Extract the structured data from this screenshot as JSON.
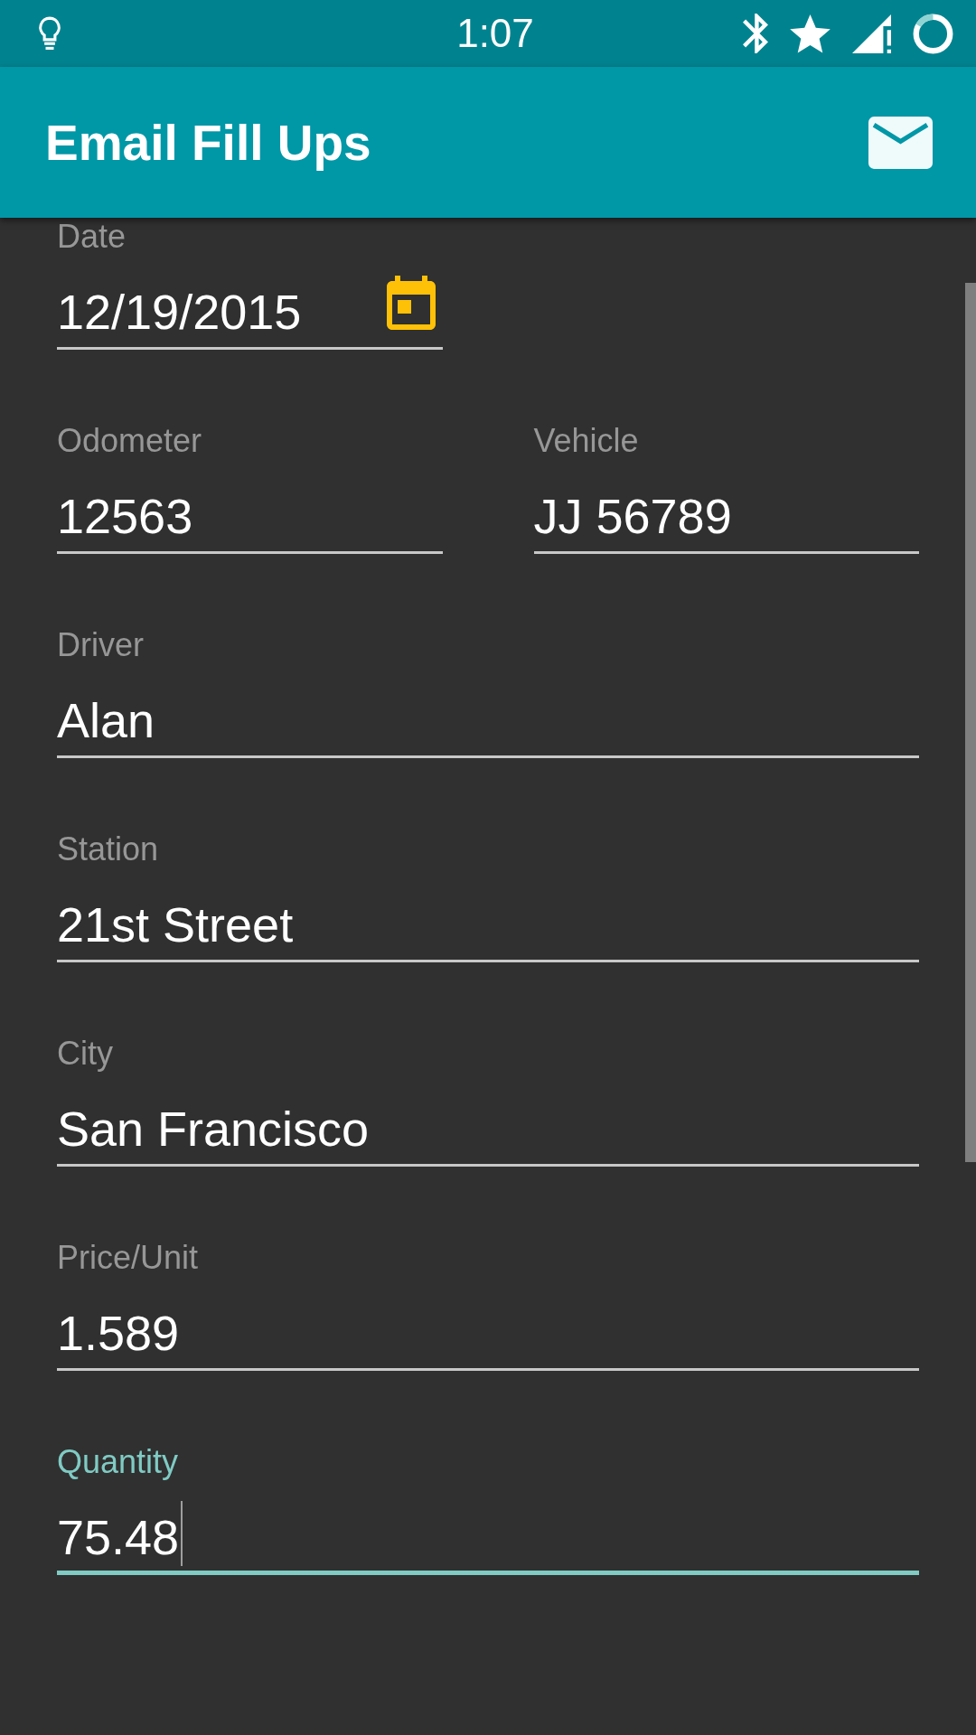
{
  "status_bar": {
    "time": "1:07"
  },
  "app_bar": {
    "title": "Email Fill Ups"
  },
  "form": {
    "rows": [
      {
        "fields": [
          {
            "kind": "date",
            "label": "Date",
            "value": "12/19/2015",
            "focused": false
          }
        ]
      },
      {
        "fields": [
          {
            "kind": "text",
            "label": "Odometer",
            "value": "12563",
            "focused": false
          },
          {
            "kind": "text",
            "label": "Vehicle",
            "value": "JJ 56789",
            "focused": false
          }
        ]
      },
      {
        "fields": [
          {
            "kind": "text",
            "label": "Driver",
            "value": "Alan",
            "focused": false
          }
        ]
      },
      {
        "fields": [
          {
            "kind": "text",
            "label": "Station",
            "value": "21st Street",
            "focused": false
          }
        ]
      },
      {
        "fields": [
          {
            "kind": "text",
            "label": "City",
            "value": "San Francisco",
            "focused": false
          }
        ]
      },
      {
        "fields": [
          {
            "kind": "text",
            "label": "Price/Unit",
            "value": "1.589",
            "focused": false
          }
        ]
      },
      {
        "fields": [
          {
            "kind": "text",
            "label": "Quantity",
            "value": "75.48",
            "focused": true
          }
        ]
      }
    ]
  }
}
